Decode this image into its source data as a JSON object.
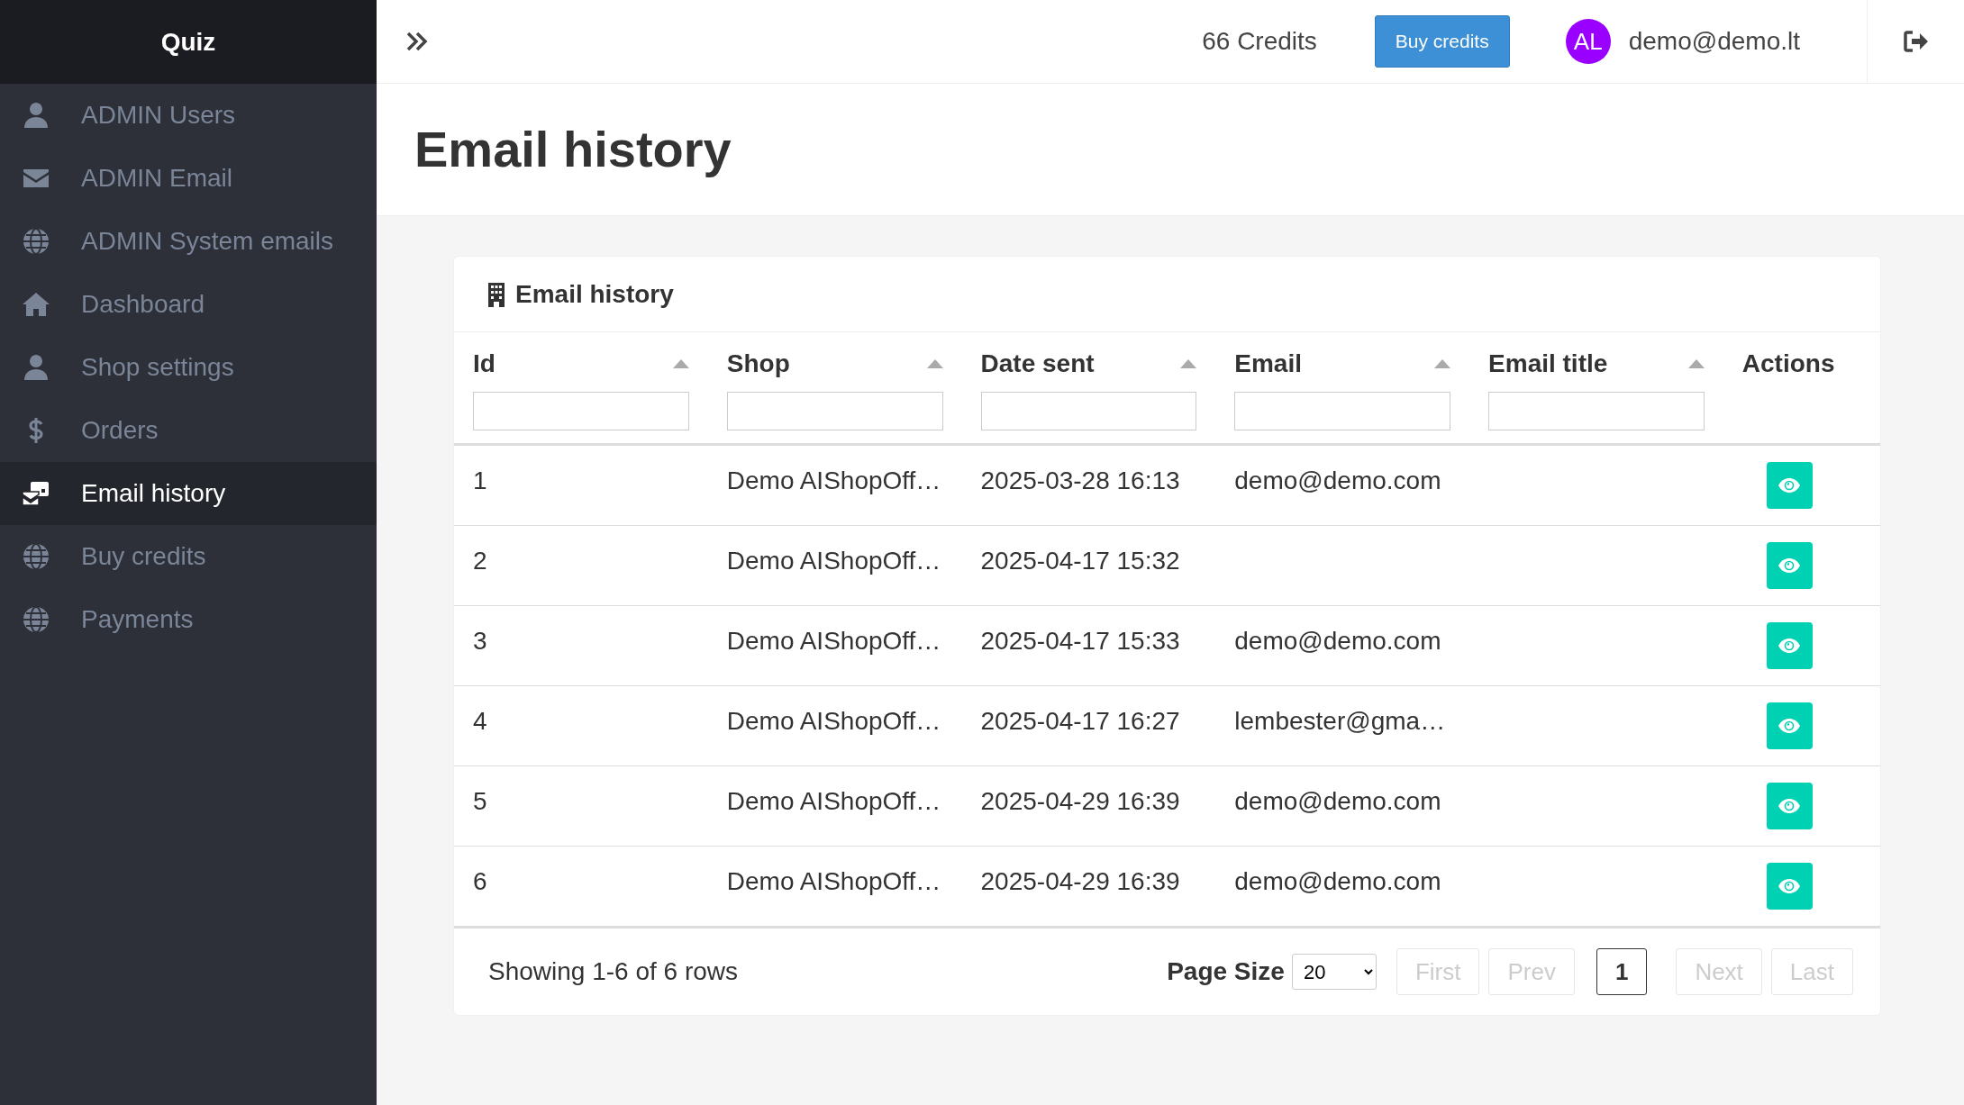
{
  "brand": "Quiz",
  "sidebar": {
    "items": [
      {
        "label": "ADMIN Users",
        "selected": false
      },
      {
        "label": "ADMIN Email",
        "selected": false
      },
      {
        "label": "ADMIN System emails",
        "selected": false
      },
      {
        "label": "Dashboard",
        "selected": false
      },
      {
        "label": "Shop settings",
        "selected": false
      },
      {
        "label": "Orders",
        "selected": false
      },
      {
        "label": "Email history",
        "selected": true
      },
      {
        "label": "Buy credits",
        "selected": false
      },
      {
        "label": "Payments",
        "selected": false
      }
    ]
  },
  "topbar": {
    "credits": "66 Credits",
    "buy_button": "Buy credits",
    "avatar": "AL",
    "user": "demo@demo.lt"
  },
  "page_title": "Email history",
  "card": {
    "title": "Email history",
    "table": {
      "columns": [
        {
          "label": "Id",
          "sortable": true,
          "filter": true
        },
        {
          "label": "Shop",
          "sortable": true,
          "filter": true
        },
        {
          "label": "Date sent",
          "sortable": true,
          "filter": true
        },
        {
          "label": "Email",
          "sortable": true,
          "filter": true
        },
        {
          "label": "Email title",
          "sortable": true,
          "filter": true
        },
        {
          "label": "Actions",
          "sortable": false,
          "filter": false
        }
      ],
      "rows": [
        {
          "id": "1",
          "shop": "Demo AIShopOff…",
          "date_sent": "2025-03-28 16:13",
          "email": "demo@demo.com",
          "email_title": ""
        },
        {
          "id": "2",
          "shop": "Demo AIShopOff…",
          "date_sent": "2025-04-17 15:32",
          "email": "",
          "email_title": ""
        },
        {
          "id": "3",
          "shop": "Demo AIShopOff…",
          "date_sent": "2025-04-17 15:33",
          "email": "demo@demo.com",
          "email_title": ""
        },
        {
          "id": "4",
          "shop": "Demo AIShopOff…",
          "date_sent": "2025-04-17 16:27",
          "email": "lembester@gma…",
          "email_title": ""
        },
        {
          "id": "5",
          "shop": "Demo AIShopOff…",
          "date_sent": "2025-04-29 16:39",
          "email": "demo@demo.com",
          "email_title": ""
        },
        {
          "id": "6",
          "shop": "Demo AIShopOff…",
          "date_sent": "2025-04-29 16:39",
          "email": "demo@demo.com",
          "email_title": ""
        }
      ]
    },
    "footer": {
      "summary": "Showing 1-6 of 6 rows",
      "page_size_label": "Page Size",
      "page_size": "20",
      "pages": [
        {
          "label": "First",
          "disabled": true,
          "selected": false
        },
        {
          "label": "Prev",
          "disabled": true,
          "selected": false
        },
        {
          "label": "1",
          "disabled": false,
          "selected": true
        },
        {
          "label": "Next",
          "disabled": true,
          "selected": false
        },
        {
          "label": "Last",
          "disabled": true,
          "selected": false
        }
      ]
    }
  }
}
